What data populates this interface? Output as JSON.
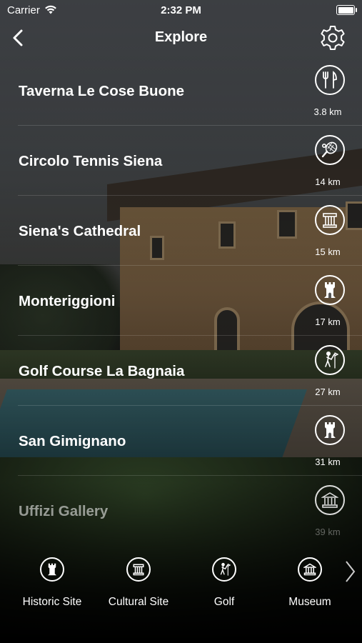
{
  "status_bar": {
    "carrier": "Carrier",
    "time": "2:32 PM"
  },
  "nav": {
    "title": "Explore",
    "back_icon": "chevron-left-icon",
    "settings_icon": "gear-icon"
  },
  "places": [
    {
      "name": "Taverna Le Cose Buone",
      "distance": "3.8 km",
      "icon": "fork-knife-icon"
    },
    {
      "name": "Circolo Tennis Siena",
      "distance": "14 km",
      "icon": "tennis-racket-icon"
    },
    {
      "name": "Siena's Cathedral",
      "distance": "15 km",
      "icon": "cultural-site-icon"
    },
    {
      "name": "Monteriggioni",
      "distance": "17 km",
      "icon": "castle-tower-icon"
    },
    {
      "name": "Golf Course La Bagnaia",
      "distance": "27 km",
      "icon": "golf-icon"
    },
    {
      "name": "San Gimignano",
      "distance": "31 km",
      "icon": "castle-tower-icon"
    },
    {
      "name": "Uffizi Gallery",
      "distance": "39 km",
      "icon": "museum-icon"
    }
  ],
  "categories": [
    {
      "label": "Historic Site",
      "icon": "castle-tower-icon"
    },
    {
      "label": "Cultural Site",
      "icon": "cultural-site-icon"
    },
    {
      "label": "Golf",
      "icon": "golf-icon"
    },
    {
      "label": "Museum",
      "icon": "museum-icon"
    }
  ],
  "colors": {
    "text": "#ffffff",
    "separator": "rgba(255,255,255,0.14)"
  }
}
